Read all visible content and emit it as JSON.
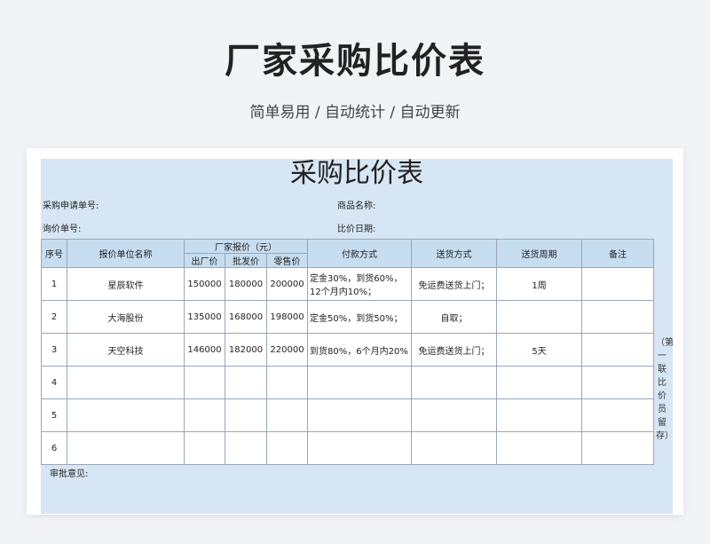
{
  "header": {
    "title": "厂家采购比价表",
    "subtitle": "简单易用 / 自动统计 / 自动更新"
  },
  "sheet": {
    "title": "采购比价表",
    "labels": {
      "request_no": "采购申请单号:",
      "product_name": "商品名称:",
      "inquiry_no": "询价单号:",
      "compare_date": "比价日期:"
    },
    "columns": {
      "seq": "序号",
      "vendor": "报价单位名称",
      "quote_group": "厂家报价（元）",
      "factory_price": "出厂价",
      "wholesale_price": "批发价",
      "retail_price": "零售价",
      "payment": "付款方式",
      "delivery": "送货方式",
      "delivery_cycle": "送货周期",
      "remarks": "备注"
    },
    "rows": [
      {
        "seq": "1",
        "vendor": "星辰软件",
        "factory": "150000",
        "wholesale": "180000",
        "retail": "200000",
        "payment_line1": "定金30%，到货60%，",
        "payment_line2": "12个月内10%；",
        "delivery": "免运费送货上门；",
        "cycle": "1周",
        "remarks": ""
      },
      {
        "seq": "2",
        "vendor": "大海股份",
        "factory": "135000",
        "wholesale": "168000",
        "retail": "198000",
        "payment_line1": "定金50%，到货50%；",
        "payment_line2": "",
        "delivery": "自取；",
        "cycle": "",
        "remarks": ""
      },
      {
        "seq": "3",
        "vendor": "天空科技",
        "factory": "146000",
        "wholesale": "182000",
        "retail": "220000",
        "payment_line1": "到货80%，6个月内20%",
        "payment_line2": "",
        "delivery": "免运费送货上门；",
        "cycle": "5天",
        "remarks": ""
      },
      {
        "seq": "4",
        "vendor": "",
        "factory": "",
        "wholesale": "",
        "retail": "",
        "payment_line1": "",
        "payment_line2": "",
        "delivery": "",
        "cycle": "",
        "remarks": ""
      },
      {
        "seq": "5",
        "vendor": "",
        "factory": "",
        "wholesale": "",
        "retail": "",
        "payment_line1": "",
        "payment_line2": "",
        "delivery": "",
        "cycle": "",
        "remarks": ""
      },
      {
        "seq": "6",
        "vendor": "",
        "factory": "",
        "wholesale": "",
        "retail": "",
        "payment_line1": "",
        "payment_line2": "",
        "delivery": "",
        "cycle": "",
        "remarks": ""
      }
    ],
    "side_note": "（第一联比价员留存）",
    "review_label": "审批意见:"
  }
}
